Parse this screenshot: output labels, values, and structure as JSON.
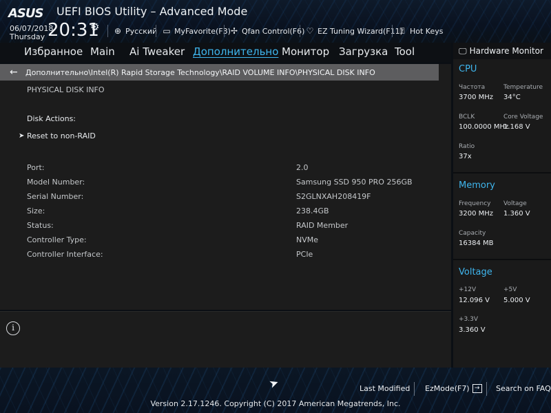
{
  "header": {
    "logo": "ASUS",
    "title": "UEFI BIOS Utility – Advanced Mode",
    "date": "06/07/2018",
    "day": "Thursday",
    "time": "20:31",
    "toolbar": [
      {
        "label": "Русский",
        "icon": "globe-icon"
      },
      {
        "label": "MyFavorite(F3)",
        "icon": "favorite-icon"
      },
      {
        "label": "Qfan Control(F6)",
        "icon": "fan-icon"
      },
      {
        "label": "EZ Tuning Wizard(F11)",
        "icon": "wizard-icon"
      },
      {
        "label": "Hot Keys",
        "icon": "help-icon"
      }
    ]
  },
  "tabs": [
    {
      "label": "Избранное",
      "active": false
    },
    {
      "label": "Main",
      "active": false
    },
    {
      "label": "Ai Tweaker",
      "active": false
    },
    {
      "label": "Дополнительно",
      "active": true
    },
    {
      "label": "Монитор",
      "active": false
    },
    {
      "label": "Загрузка",
      "active": false
    },
    {
      "label": "Tool",
      "active": false
    }
  ],
  "breadcrumb": "Дополнительно\\Intel(R) Rapid Storage Technology\\RAID VOLUME INFO\\PHYSICAL DISK INFO",
  "main": {
    "section_title": "PHYSICAL DISK INFO",
    "disk_actions_label": "Disk Actions:",
    "reset_action": "Reset to non-RAID",
    "fields": [
      {
        "label": "Port:",
        "value": "2.0"
      },
      {
        "label": "Model Number:",
        "value": "Samsung SSD 950 PRO 256GB"
      },
      {
        "label": "Serial Number:",
        "value": "S2GLNXAH208419F"
      },
      {
        "label": "Size:",
        "value": "238.4GB"
      },
      {
        "label": "Status:",
        "value": "RAID Member"
      },
      {
        "label": "Controller Type:",
        "value": "NVMe"
      },
      {
        "label": "Controller Interface:",
        "value": "PCIe"
      }
    ]
  },
  "hw_monitor": {
    "title": "Hardware Monitor",
    "cpu": {
      "title": "CPU",
      "freq_label": "Частота",
      "freq": "3700 MHz",
      "temp_label": "Temperature",
      "temp": "34°C",
      "bclk_label": "BCLK",
      "bclk": "100.0000 MHz",
      "vcore_label": "Core Voltage",
      "vcore": "1.168 V",
      "ratio_label": "Ratio",
      "ratio": "37x"
    },
    "memory": {
      "title": "Memory",
      "freq_label": "Frequency",
      "freq": "3200 MHz",
      "volt_label": "Voltage",
      "volt": "1.360 V",
      "cap_label": "Capacity",
      "cap": "16384 MB"
    },
    "voltage": {
      "title": "Voltage",
      "v12_label": "+12V",
      "v12": "12.096 V",
      "v5_label": "+5V",
      "v5": "5.000 V",
      "v33_label": "+3.3V",
      "v33": "3.360 V"
    }
  },
  "footer": {
    "last_modified": "Last Modified",
    "ezmode": "EzMode(F7)",
    "search": "Search on FAQ",
    "version": "Version 2.17.1246. Copyright (C) 2017 American Megatrends, Inc."
  },
  "colors": {
    "accent": "#3fb6ee",
    "breadcrumb_bg": "#5d5d5f",
    "panel_bg": "#1c1c1c"
  }
}
